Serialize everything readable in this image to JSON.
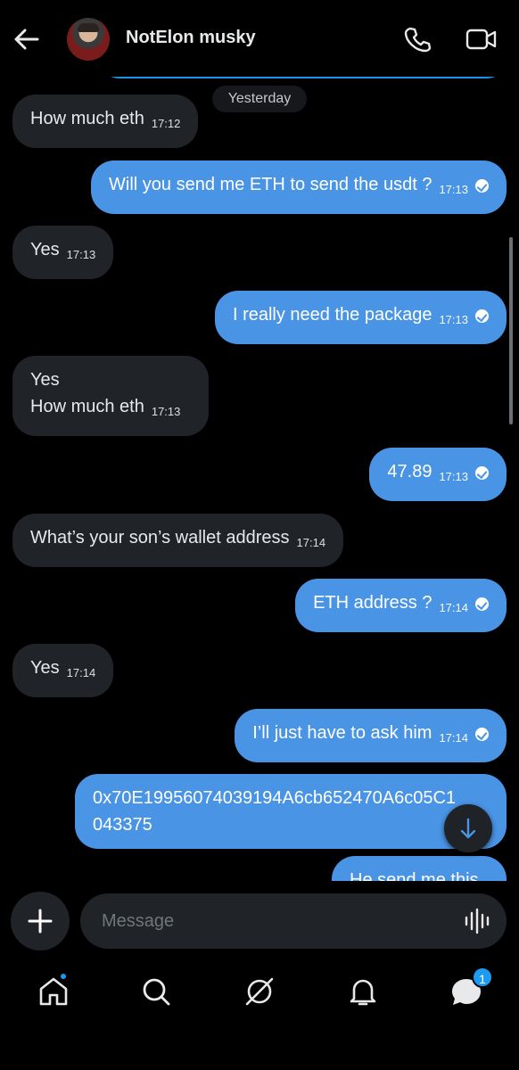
{
  "header": {
    "contact_name": "NotElon musky"
  },
  "chat": {
    "date_separator": "Yesterday",
    "messages": [
      {
        "direction": "in",
        "text": "How much eth",
        "time": "17:12"
      },
      {
        "direction": "out",
        "text": "Will you send me ETH to send the usdt ?",
        "time": "17:13"
      },
      {
        "direction": "in",
        "text": "Yes",
        "time": "17:13"
      },
      {
        "direction": "out",
        "text": "I really need the package",
        "time": "17:13"
      },
      {
        "direction": "in",
        "line1": "Yes",
        "line2": "How much eth",
        "time": "17:13"
      },
      {
        "direction": "out",
        "text": "47.89",
        "time": "17:13"
      },
      {
        "direction": "in",
        "text": "What’s your son’s wallet address",
        "time": "17:14"
      },
      {
        "direction": "out",
        "text": "ETH address ?",
        "time": "17:14"
      },
      {
        "direction": "in",
        "text": "Yes",
        "time": "17:14"
      },
      {
        "direction": "out",
        "text": "I’ll just have to ask him",
        "time": "17:14"
      },
      {
        "direction": "out",
        "line1": "0x70E19956074039194A6cb652470A6c05C1",
        "line2": "043375"
      },
      {
        "direction": "out",
        "text": "He send me this"
      }
    ]
  },
  "composer": {
    "placeholder": "Message"
  },
  "nav": {
    "messages_badge": "1"
  },
  "colors": {
    "accent": "#1d9bf0",
    "outgoing_bubble": "#4a94e6",
    "incoming_bubble": "#202327"
  }
}
